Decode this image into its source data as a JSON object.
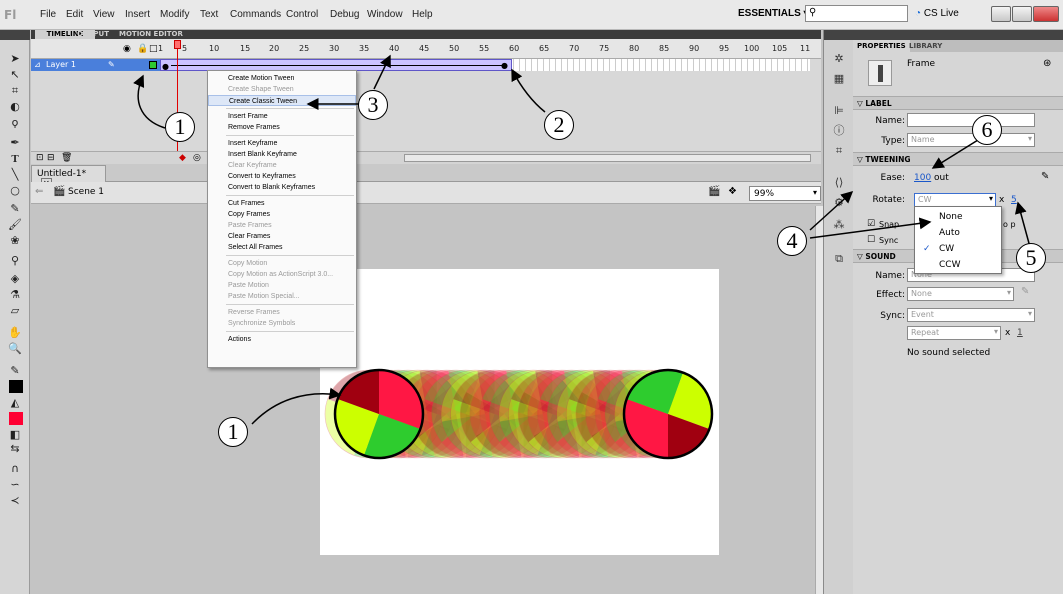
{
  "menubar": {
    "logo": "Fl",
    "items": [
      "File",
      "Edit",
      "View",
      "Insert",
      "Modify",
      "Text",
      "Commands",
      "Control",
      "Debug",
      "Window",
      "Help"
    ],
    "workspace": "ESSENTIALS ▾",
    "cslive": "CS Live"
  },
  "timeline": {
    "tabs": [
      "TIMELINE",
      "OUTPUT",
      "MOTION EDITOR"
    ],
    "frame_numbers": [
      "1",
      "5",
      "10",
      "15",
      "20",
      "25",
      "30",
      "35",
      "40",
      "45",
      "50",
      "55",
      "60",
      "65",
      "70",
      "75",
      "80",
      "85",
      "90",
      "95",
      "100",
      "105",
      "11"
    ],
    "layer_name": "Layer 1"
  },
  "document": {
    "tab": "Untitled-1*",
    "scene": "Scene 1",
    "zoom": "99%"
  },
  "context_menu": {
    "items": [
      {
        "label": "Create Motion Tween",
        "enabled": true
      },
      {
        "label": "Create Shape Tween",
        "enabled": false
      },
      {
        "label": "Create Classic Tween",
        "enabled": true,
        "highlight": true
      },
      {
        "sep": true
      },
      {
        "label": "Insert Frame",
        "enabled": true
      },
      {
        "label": "Remove Frames",
        "enabled": true
      },
      {
        "sep": true
      },
      {
        "label": "Insert Keyframe",
        "enabled": true
      },
      {
        "label": "Insert Blank Keyframe",
        "enabled": true
      },
      {
        "label": "Clear Keyframe",
        "enabled": false
      },
      {
        "label": "Convert to Keyframes",
        "enabled": true
      },
      {
        "label": "Convert to Blank Keyframes",
        "enabled": true
      },
      {
        "sep": true
      },
      {
        "label": "Cut Frames",
        "enabled": true
      },
      {
        "label": "Copy Frames",
        "enabled": true
      },
      {
        "label": "Paste Frames",
        "enabled": false
      },
      {
        "label": "Clear Frames",
        "enabled": true
      },
      {
        "label": "Select All Frames",
        "enabled": true
      },
      {
        "sep": true
      },
      {
        "label": "Copy Motion",
        "enabled": false
      },
      {
        "label": "Copy Motion as ActionScript 3.0...",
        "enabled": false
      },
      {
        "label": "Paste Motion",
        "enabled": false
      },
      {
        "label": "Paste Motion Special...",
        "enabled": false
      },
      {
        "sep": true
      },
      {
        "label": "Reverse Frames",
        "enabled": false
      },
      {
        "label": "Synchronize Symbols",
        "enabled": false
      },
      {
        "sep": true
      },
      {
        "label": "Actions",
        "enabled": true
      }
    ]
  },
  "properties": {
    "tabs": [
      "PROPERTIES",
      "LIBRARY"
    ],
    "frame_label": "Frame",
    "label_section": "LABEL",
    "name_label": "Name:",
    "name_value": "",
    "type_label": "Type:",
    "type_value": "Name",
    "tweening_section": "TWEENING",
    "ease_label": "Ease:",
    "ease_value": "100",
    "ease_suffix": "out",
    "rotate_label": "Rotate:",
    "rotate_value": "CW",
    "rotate_x": "x",
    "rotate_count": "5",
    "snap_label": "Snap",
    "orient_partial": "o p",
    "sync_label": "Sync",
    "sound_section": "SOUND",
    "sound_name_label": "Name:",
    "sound_name_value": "None",
    "effect_label": "Effect:",
    "effect_value": "None",
    "sound_sync_label": "Sync:",
    "sound_sync_value": "Event",
    "repeat_value": "Repeat",
    "repeat_x": "x",
    "repeat_count": "1",
    "no_sound": "No sound selected"
  },
  "rotate_dropdown": {
    "options": [
      "None",
      "Auto",
      "CW",
      "CCW"
    ],
    "checked": "CW",
    "check_mark": "✓"
  },
  "callouts": [
    "1",
    "2",
    "3",
    "4",
    "5",
    "6",
    "1"
  ],
  "colors": {
    "pie_red": "#ff1744",
    "pie_green": "#2ecc2e",
    "pie_yellow": "#ccff00",
    "pie_dark": "#a00010"
  }
}
